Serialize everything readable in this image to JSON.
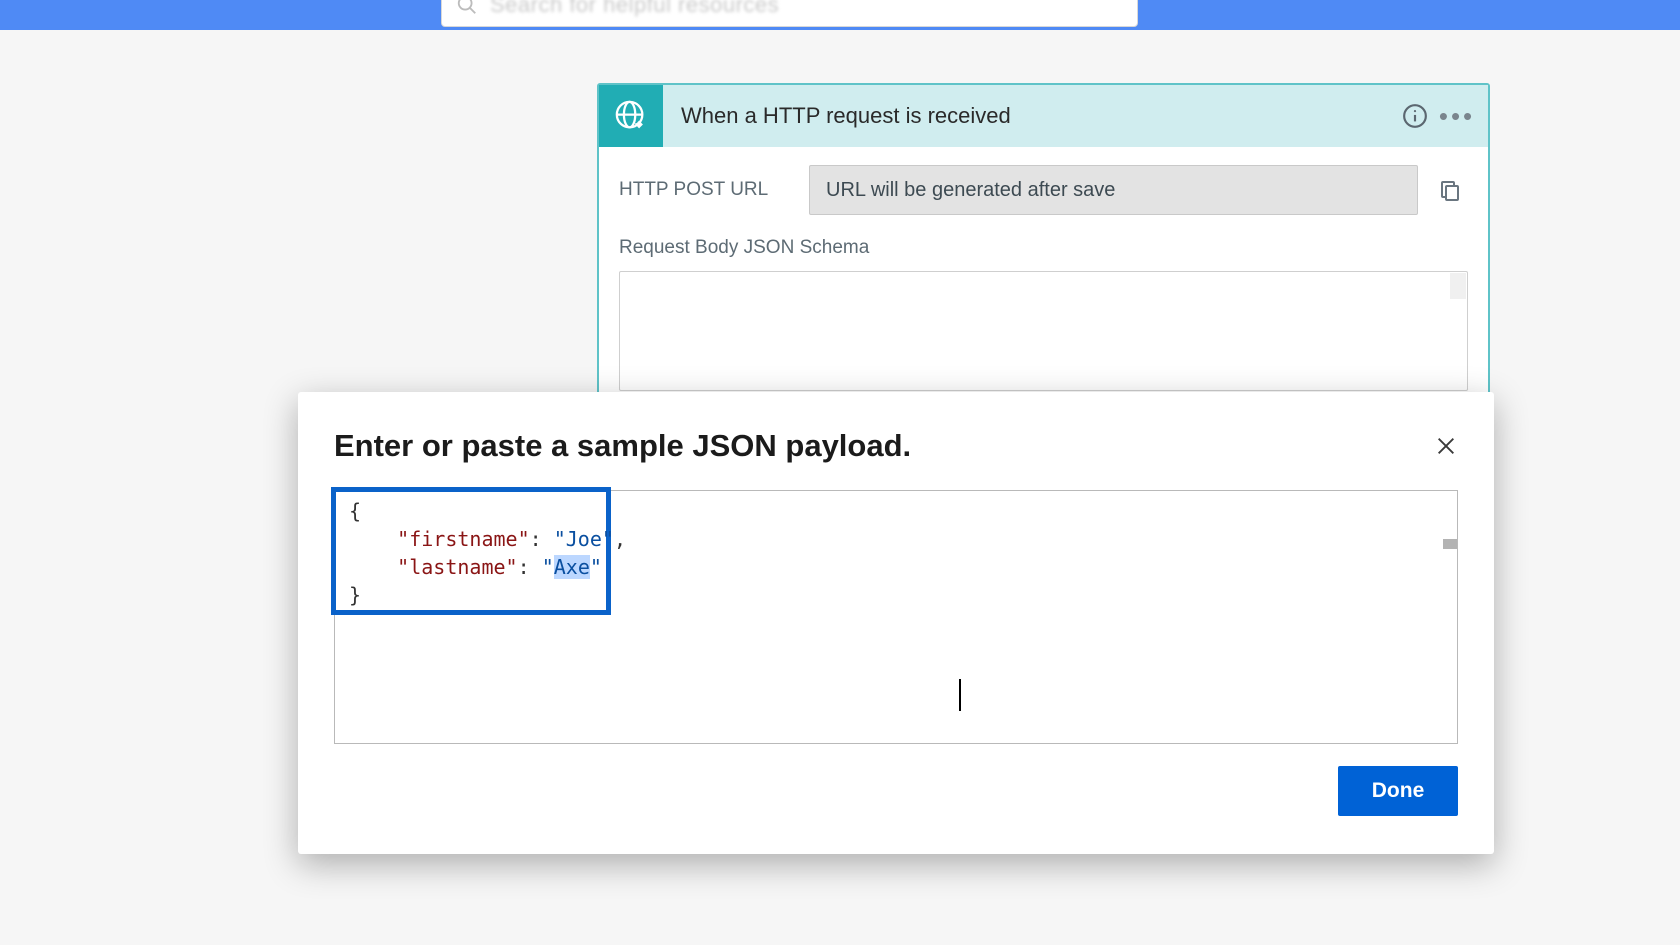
{
  "search": {
    "placeholder": "Search for helpful resources"
  },
  "trigger": {
    "title": "When a HTTP request is received",
    "url_label": "HTTP POST URL",
    "url_value": "URL will be generated after save",
    "schema_label": "Request Body JSON Schema"
  },
  "modal": {
    "title": "Enter or paste a sample JSON payload.",
    "done_label": "Done",
    "json_payload": {
      "keys": [
        "firstname",
        "lastname"
      ],
      "values": [
        "Joe",
        "Axe"
      ],
      "selected_value": "Axe"
    }
  }
}
